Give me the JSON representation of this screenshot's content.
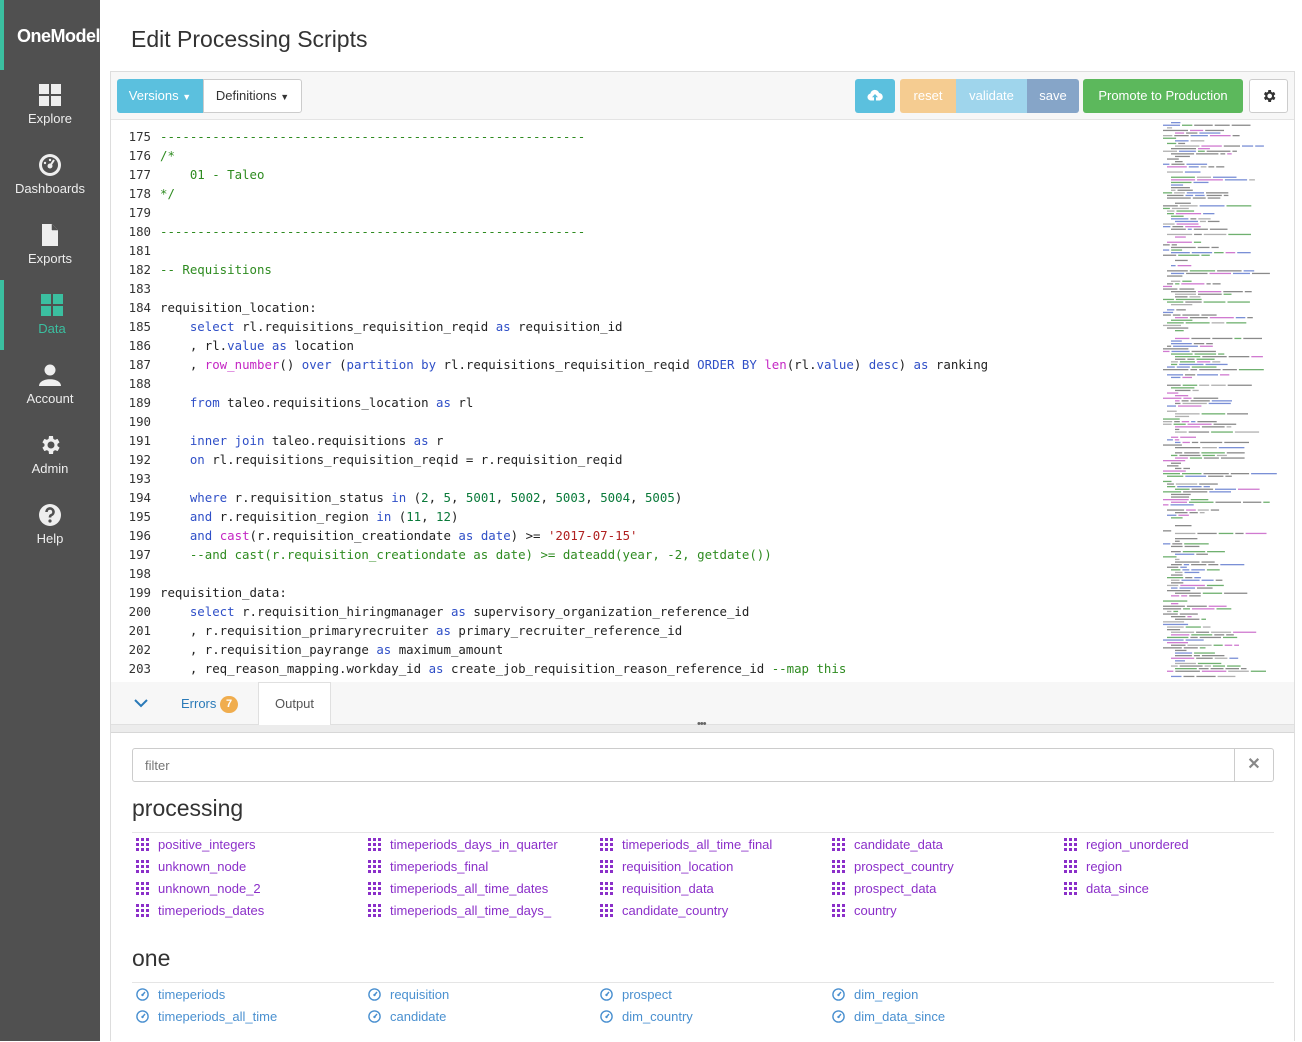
{
  "app": {
    "logo": "OneModel",
    "page_title": "Edit Processing Scripts"
  },
  "nav": [
    {
      "label": "Explore",
      "icon": "grid-icon"
    },
    {
      "label": "Dashboards",
      "icon": "gauge-icon"
    },
    {
      "label": "Exports",
      "icon": "file-icon"
    },
    {
      "label": "Data",
      "icon": "grid-icon",
      "active": true
    },
    {
      "label": "Account",
      "icon": "user-icon"
    },
    {
      "label": "Admin",
      "icon": "gear-icon"
    },
    {
      "label": "Help",
      "icon": "help-icon"
    }
  ],
  "toolbar": {
    "versions": "Versions",
    "definitions": "Definitions",
    "reset": "reset",
    "validate": "validate",
    "save": "save",
    "promote": "Promote to Production"
  },
  "colors": {
    "accent": "#3bbfa0",
    "info": "#5bc0de",
    "warning": "#f0ad4e",
    "success": "#5cb85c",
    "sidebar": "#505050"
  },
  "code_lines": [
    {
      "n": "175",
      "t": [
        [
          "cm",
          "---------------------------------------------------------"
        ]
      ]
    },
    {
      "n": "176",
      "t": [
        [
          "cm",
          "/*"
        ]
      ]
    },
    {
      "n": "177",
      "t": [
        [
          "cm",
          "    01 - Taleo"
        ]
      ]
    },
    {
      "n": "178",
      "t": [
        [
          "cm",
          "*/"
        ]
      ]
    },
    {
      "n": "179",
      "t": []
    },
    {
      "n": "180",
      "t": [
        [
          "cm",
          "---------------------------------------------------------"
        ]
      ]
    },
    {
      "n": "181",
      "t": []
    },
    {
      "n": "182",
      "t": [
        [
          "cm",
          "-- Requisitions"
        ]
      ]
    },
    {
      "n": "183",
      "t": []
    },
    {
      "n": "184",
      "t": [
        [
          "",
          "requisition_location:"
        ]
      ]
    },
    {
      "n": "185",
      "t": [
        [
          "",
          "    "
        ],
        [
          "kw",
          "select"
        ],
        [
          "",
          " rl.requisitions_requisition_reqid "
        ],
        [
          "kw",
          "as"
        ],
        [
          "",
          " requisition_id"
        ]
      ]
    },
    {
      "n": "186",
      "t": [
        [
          "",
          "    , rl."
        ],
        [
          "kw",
          "value"
        ],
        [
          "",
          " "
        ],
        [
          "kw",
          "as"
        ],
        [
          "",
          " location"
        ]
      ]
    },
    {
      "n": "187",
      "t": [
        [
          "",
          "    , "
        ],
        [
          "fn",
          "row_number"
        ],
        [
          "",
          "() "
        ],
        [
          "kw",
          "over"
        ],
        [
          "",
          " ("
        ],
        [
          "kw",
          "partition"
        ],
        [
          "",
          " "
        ],
        [
          "kw",
          "by"
        ],
        [
          "",
          " rl.requisitions_requisition_reqid "
        ],
        [
          "kw",
          "ORDER BY"
        ],
        [
          "",
          " "
        ],
        [
          "fn",
          "len"
        ],
        [
          "",
          "(rl."
        ],
        [
          "kw",
          "value"
        ],
        [
          "",
          ") "
        ],
        [
          "kw",
          "desc"
        ],
        [
          "",
          ") "
        ],
        [
          "kw",
          "as"
        ],
        [
          "",
          " ranking"
        ]
      ]
    },
    {
      "n": "188",
      "t": []
    },
    {
      "n": "189",
      "t": [
        [
          "",
          "    "
        ],
        [
          "kw",
          "from"
        ],
        [
          "",
          " taleo.requisitions_location "
        ],
        [
          "kw",
          "as"
        ],
        [
          "",
          " rl"
        ]
      ]
    },
    {
      "n": "190",
      "t": []
    },
    {
      "n": "191",
      "t": [
        [
          "",
          "    "
        ],
        [
          "kw",
          "inner join"
        ],
        [
          "",
          " taleo.requisitions "
        ],
        [
          "kw",
          "as"
        ],
        [
          "",
          " r"
        ]
      ]
    },
    {
      "n": "192",
      "t": [
        [
          "",
          "    "
        ],
        [
          "kw",
          "on"
        ],
        [
          "",
          " rl.requisitions_requisition_reqid = r.requisition_reqid"
        ]
      ]
    },
    {
      "n": "193",
      "t": []
    },
    {
      "n": "194",
      "t": [
        [
          "",
          "    "
        ],
        [
          "kw",
          "where"
        ],
        [
          "",
          " r.requisition_status "
        ],
        [
          "kw",
          "in"
        ],
        [
          "",
          " ("
        ],
        [
          "nm",
          "2"
        ],
        [
          "",
          ", "
        ],
        [
          "nm",
          "5"
        ],
        [
          "",
          ", "
        ],
        [
          "nm",
          "5001"
        ],
        [
          "",
          ", "
        ],
        [
          "nm",
          "5002"
        ],
        [
          "",
          ", "
        ],
        [
          "nm",
          "5003"
        ],
        [
          "",
          ", "
        ],
        [
          "nm",
          "5004"
        ],
        [
          "",
          ", "
        ],
        [
          "nm",
          "5005"
        ],
        [
          "",
          ")"
        ]
      ]
    },
    {
      "n": "195",
      "t": [
        [
          "",
          "    "
        ],
        [
          "kw",
          "and"
        ],
        [
          "",
          " r.requisition_region "
        ],
        [
          "kw",
          "in"
        ],
        [
          "",
          " ("
        ],
        [
          "nm",
          "11"
        ],
        [
          "",
          ", "
        ],
        [
          "nm",
          "12"
        ],
        [
          "",
          ")"
        ]
      ]
    },
    {
      "n": "196",
      "t": [
        [
          "",
          "    "
        ],
        [
          "kw",
          "and"
        ],
        [
          "",
          " "
        ],
        [
          "fn",
          "cast"
        ],
        [
          "",
          "(r.requisition_creationdate "
        ],
        [
          "kw",
          "as"
        ],
        [
          "",
          " "
        ],
        [
          "kw",
          "date"
        ],
        [
          "",
          ") >= "
        ],
        [
          "st",
          "'2017-07-15'"
        ]
      ]
    },
    {
      "n": "197",
      "t": [
        [
          "cm",
          "    --and cast(r.requisition_creationdate as date) >= dateadd(year, -2, getdate())"
        ]
      ]
    },
    {
      "n": "198",
      "t": []
    },
    {
      "n": "199",
      "t": [
        [
          "",
          "requisition_data:"
        ]
      ]
    },
    {
      "n": "200",
      "t": [
        [
          "",
          "    "
        ],
        [
          "kw",
          "select"
        ],
        [
          "",
          " r.requisition_hiringmanager "
        ],
        [
          "kw",
          "as"
        ],
        [
          "",
          " supervisory_organization_reference_id"
        ]
      ]
    },
    {
      "n": "201",
      "t": [
        [
          "",
          "    , r.requisition_primaryrecruiter "
        ],
        [
          "kw",
          "as"
        ],
        [
          "",
          " primary_recruiter_reference_id"
        ]
      ]
    },
    {
      "n": "202",
      "t": [
        [
          "",
          "    , r.requisition_payrange "
        ],
        [
          "kw",
          "as"
        ],
        [
          "",
          " maximum_amount"
        ]
      ]
    },
    {
      "n": "203",
      "t": [
        [
          "",
          "    , req_reason_mapping.workday_id "
        ],
        [
          "kw",
          "as"
        ],
        [
          "",
          " create_job_requisition_reason_reference_id "
        ],
        [
          "cm",
          "--map this"
        ]
      ]
    }
  ],
  "tabs": {
    "errors": "Errors",
    "errors_count": "7",
    "output": "Output"
  },
  "filter": {
    "placeholder": "filter"
  },
  "sections": [
    {
      "title": "processing",
      "columns": [
        [
          "positive_integers",
          "unknown_node",
          "unknown_node_2",
          "timeperiods_dates"
        ],
        [
          "timeperiods_days_in_quarter",
          "timeperiods_final",
          "timeperiods_all_time_dates",
          "timeperiods_all_time_days_"
        ],
        [
          "timeperiods_all_time_final",
          "requisition_location",
          "requisition_data",
          "candidate_country"
        ],
        [
          "candidate_data",
          "prospect_country",
          "prospect_data",
          "country"
        ],
        [
          "region_unordered",
          "region",
          "data_since"
        ]
      ]
    },
    {
      "title": "one",
      "columns": [
        [
          "timeperiods",
          "timeperiods_all_time"
        ],
        [
          "requisition",
          "candidate"
        ],
        [
          "prospect",
          "dim_country"
        ],
        [
          "dim_region",
          "dim_data_since"
        ]
      ]
    }
  ]
}
